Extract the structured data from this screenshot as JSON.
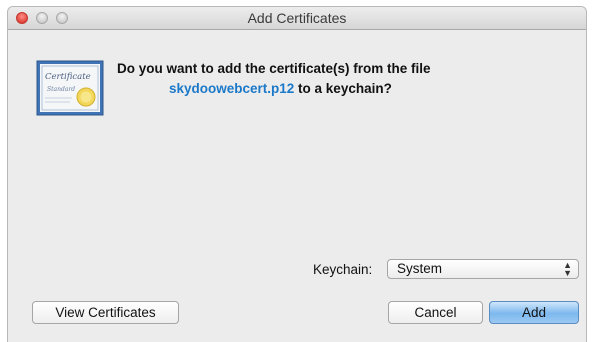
{
  "window": {
    "title": "Add Certificates"
  },
  "dialog": {
    "question_line1": "Do you want to add the certificate(s) from the file",
    "filename": "skydoowebcert.p12",
    "question_line2_suffix": " to a keychain?",
    "icon": "certificate-icon",
    "icon_text_line1": "Certificate",
    "icon_text_line2": "Standard"
  },
  "keychain": {
    "label": "Keychain:",
    "selected": "System"
  },
  "buttons": {
    "view_certificates": "View Certificates",
    "cancel": "Cancel",
    "add": "Add"
  },
  "colors": {
    "filename": "#1c79c9",
    "default_button": "#7db8ee",
    "close_button": "#e0443a"
  }
}
